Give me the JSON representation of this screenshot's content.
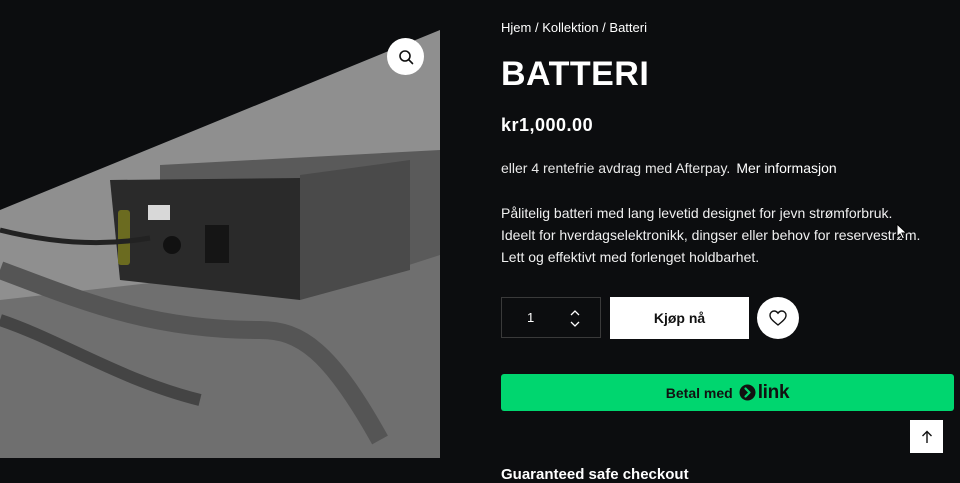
{
  "breadcrumb": {
    "home": "Hjem",
    "collection": "Kollektion",
    "current": "Batteri",
    "separator": " / "
  },
  "product": {
    "title": "BATTERI",
    "price": "kr1,000.00",
    "afterpay_text": "eller 4 rentefrie avdrag med Afterpay.",
    "afterpay_more": "Mer informasjon",
    "description": [
      "Pålitelig batteri med lang levetid designet for jevn strømforbruk.",
      "Ideelt for hverdagselektronikk, dingser eller behov for reservestrøm.",
      "Lett og effektivt med forlenget holdbarhet."
    ]
  },
  "purchase": {
    "quantity": "1",
    "buy_label": "Kjøp nå",
    "pay_label": "Betal med",
    "pay_brand": "link",
    "pay_color": "#00d66f"
  },
  "footer": {
    "guarantee": "Guaranteed safe checkout"
  },
  "icons": {
    "zoom": "magnifier-icon",
    "wishlist": "heart-icon",
    "qty_up": "chevron-up-icon",
    "qty_down": "chevron-down-icon",
    "scroll_top": "arrow-up-icon"
  }
}
